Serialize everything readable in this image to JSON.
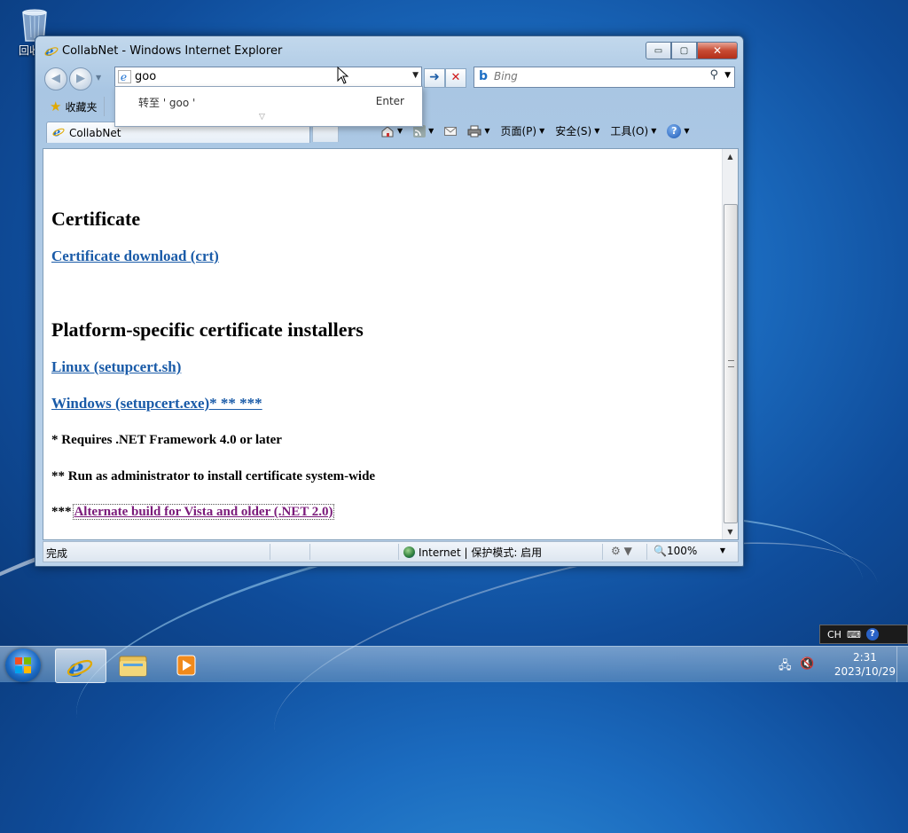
{
  "desktop": {
    "recycle_bin_label": "回收站"
  },
  "window": {
    "title": "CollabNet - Windows Internet Explorer",
    "buttons": {
      "min": "▭",
      "max": "▢",
      "close": "✕"
    }
  },
  "address_bar": {
    "value": "goo"
  },
  "autocomplete": {
    "goto_text": "转至 ' goo '",
    "enter_text": "Enter"
  },
  "search_box": {
    "placeholder": "Bing"
  },
  "favorites": {
    "label": "收藏夹"
  },
  "tab": {
    "title": "CollabNet"
  },
  "command_bar": {
    "page": "页面(P)",
    "safety": "安全(S)",
    "tools": "工具(O)"
  },
  "page": {
    "heading1": "Certificate",
    "link_crt": "Certificate download (crt)",
    "heading2": "Platform-specific certificate installers",
    "link_linux": "Linux (setupcert.sh)",
    "link_windows": "Windows (setupcert.exe)* ** ***",
    "note1": "* Requires .NET Framework 4.0 or later",
    "note2": "** Run as administrator to install certificate system-wide",
    "note3_prefix": "***",
    "link_vista": "Alternate build for Vista and older (.NET 2.0)"
  },
  "status_bar": {
    "status": "完成",
    "zone": "Internet | 保护模式: 启用",
    "zoom": "100%"
  },
  "language_bar": {
    "lang": "CH"
  },
  "clock": {
    "time": "2:31",
    "date": "2023/10/29"
  },
  "icons": [
    "ie-icon",
    "bing-icon",
    "star-icon",
    "home-icon",
    "rss-icon",
    "mail-icon",
    "print-icon",
    "help-icon",
    "globe-icon",
    "windows-flag-icon",
    "folder-icon",
    "media-player-icon",
    "network-icon",
    "volume-muted-icon"
  ]
}
